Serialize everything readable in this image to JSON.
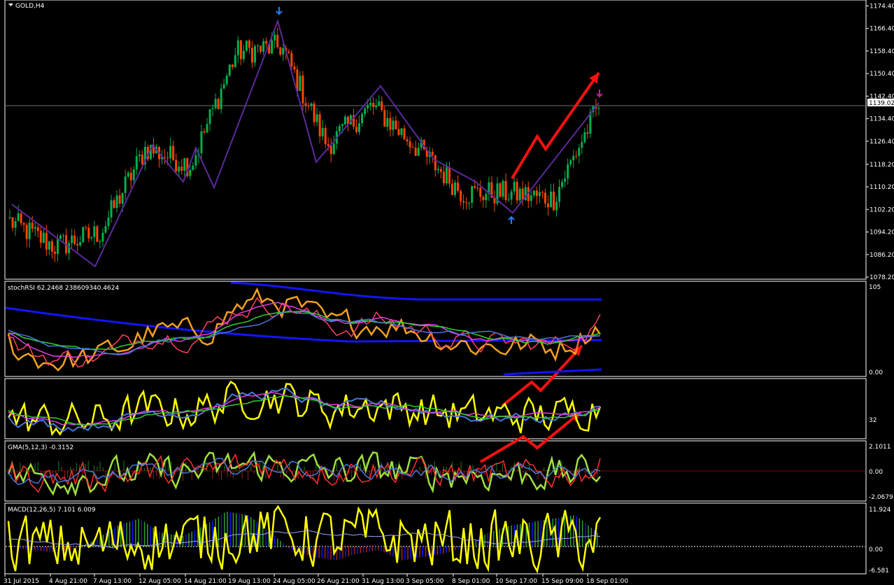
{
  "window": {
    "title": "GOLD,H4",
    "menu_icon": "triangle-down-icon"
  },
  "colors": {
    "background": "#000000",
    "frame": "#ffffff",
    "bull_candle": "#00b050",
    "bear_candle": "#ff4500",
    "zigzag": "#5b2a9a",
    "arrow": "#ff1010",
    "fractal": "#1e7fff",
    "price_line": "#707070",
    "yellow": "#ffff00",
    "blue": "#1414ff",
    "steel_blue": "#4a78d8",
    "magenta": "#e040e0",
    "green": "#30d030",
    "orange": "#f4a020",
    "pink": "#ff4060",
    "lime": "#a0e040",
    "dark_red": "#8b0000"
  },
  "main_panel": {
    "price_labels": [
      "1174.40",
      "1166.40",
      "1158.40",
      "1150.40",
      "1142.40",
      "1134.40",
      "1126.40",
      "1118.20",
      "1110.20",
      "1102.20",
      "1094.20",
      "1086.20",
      "1078.20"
    ],
    "current_price": "1139.02"
  },
  "panels": {
    "stochrsi": {
      "title": "stochRSI 62.2468 238609340.4624",
      "scale_top": "105",
      "scale_bottom": "0.00"
    },
    "rsi_panel": {
      "scale_mid": "32"
    },
    "gma": {
      "title": "GMA(5,12,3) -0.3152",
      "scale_top": "2.1011",
      "scale_mid": "0.00",
      "scale_bottom": "-2.0679"
    },
    "macd": {
      "title": "MACD(12,26,5) 7.101 6.009",
      "scale_top": "11.924",
      "scale_mid": "0.00",
      "scale_bottom": "-6.581"
    }
  },
  "time_labels": [
    "31 Jul 2015",
    "4 Aug 21:00",
    "7 Aug 13:00",
    "12 Aug 05:00",
    "14 Aug 21:00",
    "19 Aug 13:00",
    "24 Aug 05:00",
    "26 Aug 21:00",
    "31 Aug 13:00",
    "3 Sep 05:00",
    "8 Sep 01:00",
    "10 Sep 17:00",
    "15 Sep 09:00",
    "18 Sep 01:00"
  ],
  "chart_data": {
    "type": "candlestick",
    "symbol": "GOLD",
    "timeframe": "H4",
    "ylim": [
      1078.2,
      1176.0
    ],
    "current_price": 1139.02,
    "close_path": [
      {
        "x": "31 Jul 2015",
        "y": 1098
      },
      {
        "x": "4 Aug 21:00",
        "y": 1089
      },
      {
        "x": "7 Aug 13:00",
        "y": 1094
      },
      {
        "x": "12 Aug 05:00",
        "y": 1124
      },
      {
        "x": "14 Aug 21:00",
        "y": 1118
      },
      {
        "x": "19 Aug 13:00",
        "y": 1158
      },
      {
        "x": "24 Aug 05:00",
        "y": 1160
      },
      {
        "x": "26 Aug 21:00",
        "y": 1125
      },
      {
        "x": "31 Aug 13:00",
        "y": 1139
      },
      {
        "x": "3 Sep 05:00",
        "y": 1124
      },
      {
        "x": "8 Sep 01:00",
        "y": 1108
      },
      {
        "x": "10 Sep 17:00",
        "y": 1108
      },
      {
        "x": "15 Sep 09:00",
        "y": 1106
      },
      {
        "x": "18 Sep 01:00",
        "y": 1139
      }
    ],
    "zigzag_points": [
      1104,
      1082,
      1125,
      1112,
      1124,
      1110,
      1169,
      1119,
      1146,
      1120,
      1112,
      1101,
      1140
    ],
    "fractal_markers": [
      "down-arrow near 1170 at 24 Aug",
      "up-arrow near 1101 at 10 Sep",
      "down-arrow near 1140 at 18 Sep"
    ],
    "panels": [
      {
        "name": "stochRSI",
        "values_shown": [
          62.2468,
          238609340.4624
        ],
        "ylim": [
          0,
          105
        ]
      },
      {
        "name": "RSI band",
        "level": 32
      },
      {
        "name": "GMA(5,12,3)",
        "value": -0.3152,
        "ylim": [
          -2.0679,
          2.1011
        ]
      },
      {
        "name": "MACD(12,26,5)",
        "values_shown": [
          7.101,
          6.009
        ],
        "ylim": [
          -6.581,
          11.924
        ]
      }
    ]
  }
}
